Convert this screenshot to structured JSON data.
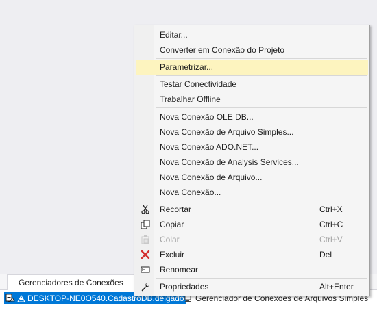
{
  "tray": {
    "tab_label": "Gerenciadores de Conexões",
    "connections": [
      {
        "label": "DESKTOP-NE0O540.CadastroDB.delgado",
        "icon": "database-connection-icon",
        "selected": true
      },
      {
        "label": "Gerenciador de Conexões de Arquivos Simples",
        "icon": "flat-file-connection-icon",
        "selected": false
      }
    ]
  },
  "menu": {
    "items": [
      {
        "label": "Editar..."
      },
      {
        "label": "Converter em Conexão do Projeto"
      },
      {
        "label": "Parametrizar...",
        "highlighted": true
      },
      {
        "label": "Testar Conectividade"
      },
      {
        "label": "Trabalhar Offline"
      },
      {
        "label": "Nova Conexão OLE DB..."
      },
      {
        "label": "Nova Conexão de Arquivo Simples..."
      },
      {
        "label": "Nova Conexão ADO.NET..."
      },
      {
        "label": "Nova Conexão de Analysis Services..."
      },
      {
        "label": "Nova Conexão de Arquivo..."
      },
      {
        "label": "Nova Conexão..."
      },
      {
        "label": "Recortar",
        "shortcut": "Ctrl+X",
        "icon": "scissors-icon"
      },
      {
        "label": "Copiar",
        "shortcut": "Ctrl+C",
        "icon": "copy-icon"
      },
      {
        "label": "Colar",
        "shortcut": "Ctrl+V",
        "icon": "paste-icon",
        "disabled": true
      },
      {
        "label": "Excluir",
        "shortcut": "Del",
        "icon": "delete-x-icon"
      },
      {
        "label": "Renomear",
        "icon": "rename-icon"
      },
      {
        "label": "Propriedades",
        "shortcut": "Alt+Enter",
        "icon": "wrench-icon"
      }
    ]
  },
  "colors": {
    "highlight": "#fdf4bf",
    "selection": "#0078d7",
    "delete_red": "#d32f2f"
  }
}
